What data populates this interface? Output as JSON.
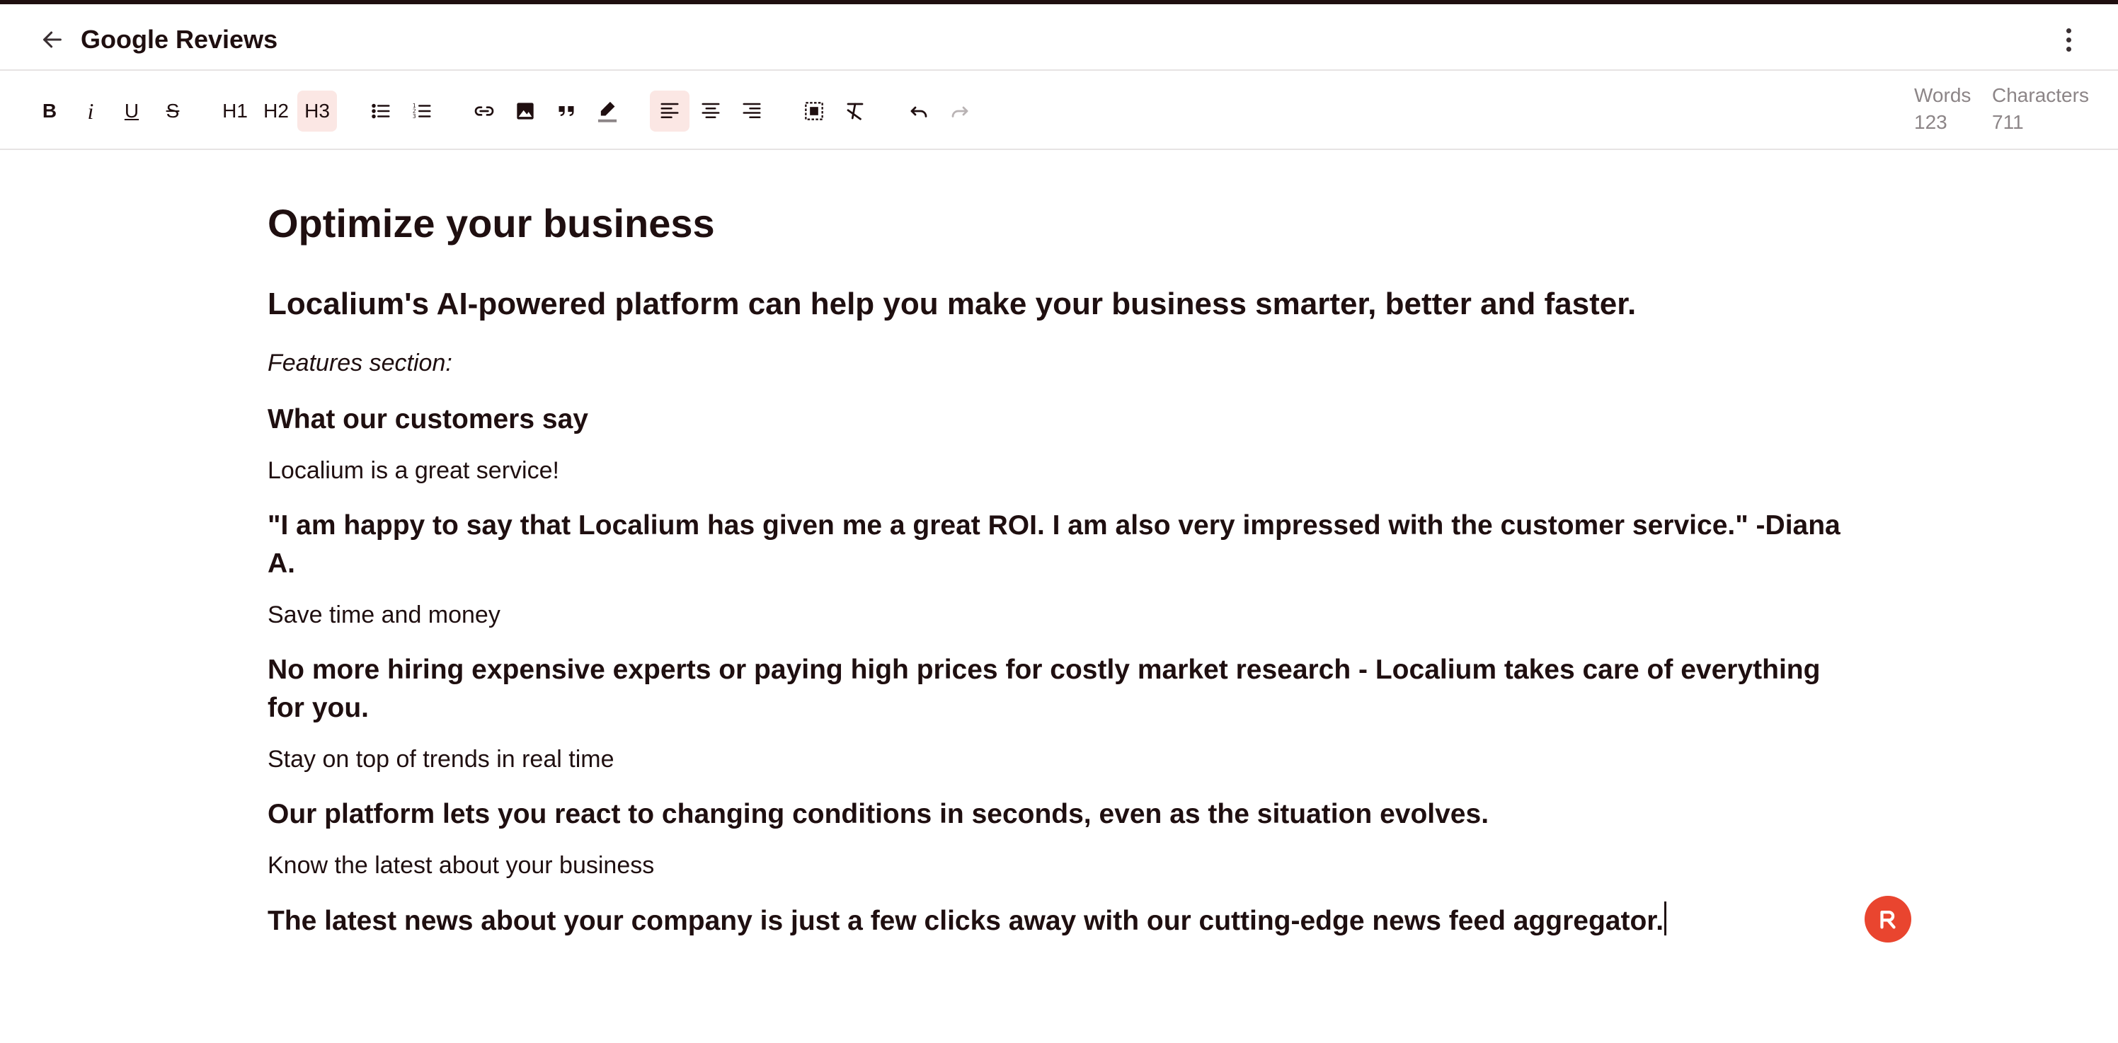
{
  "header": {
    "title": "Google Reviews"
  },
  "toolbar": {
    "bold": "B",
    "italic": "i",
    "underline": "U",
    "strike": "S",
    "h1": "H1",
    "h2": "H2",
    "h3": "H3",
    "active_items": [
      "h3",
      "align-left"
    ]
  },
  "stats": {
    "words_label": "Words",
    "words_value": "123",
    "chars_label": "Characters",
    "chars_value": "711"
  },
  "document": {
    "title": "Optimize your business",
    "subtitle": "Localium's AI-powered platform can help you make your business smarter, better and faster.",
    "features_label": "Features section:",
    "blocks": [
      {
        "type": "h3",
        "text": "What our customers say"
      },
      {
        "type": "p",
        "text": "Localium is a great service!"
      },
      {
        "type": "h3",
        "text": "\"I am happy to say that Localium has given me a great ROI. I am also very impressed with the customer service.\" -Diana A."
      },
      {
        "type": "p",
        "text": "Save time and money"
      },
      {
        "type": "h3",
        "text": "No more hiring expensive experts or paying high prices for costly market research - Localium takes care of everything for you."
      },
      {
        "type": "p",
        "text": "Stay on top of trends in real time"
      },
      {
        "type": "h3",
        "text": "Our platform lets you react to changing conditions in seconds, even as the situation evolves."
      },
      {
        "type": "p",
        "text": "Know the latest about your business"
      },
      {
        "type": "h3",
        "text": "The latest news about your company is just a few clicks away with our cutting-edge news feed aggregator."
      }
    ]
  },
  "colors": {
    "text": "#1f0f10",
    "accent": "#e9452f",
    "active_bg": "#fbe7e4",
    "muted": "#8c8587"
  },
  "icons": {
    "back": "arrow-left-icon",
    "menu": "more-vertical-icon",
    "fab": "r-logo-icon"
  }
}
